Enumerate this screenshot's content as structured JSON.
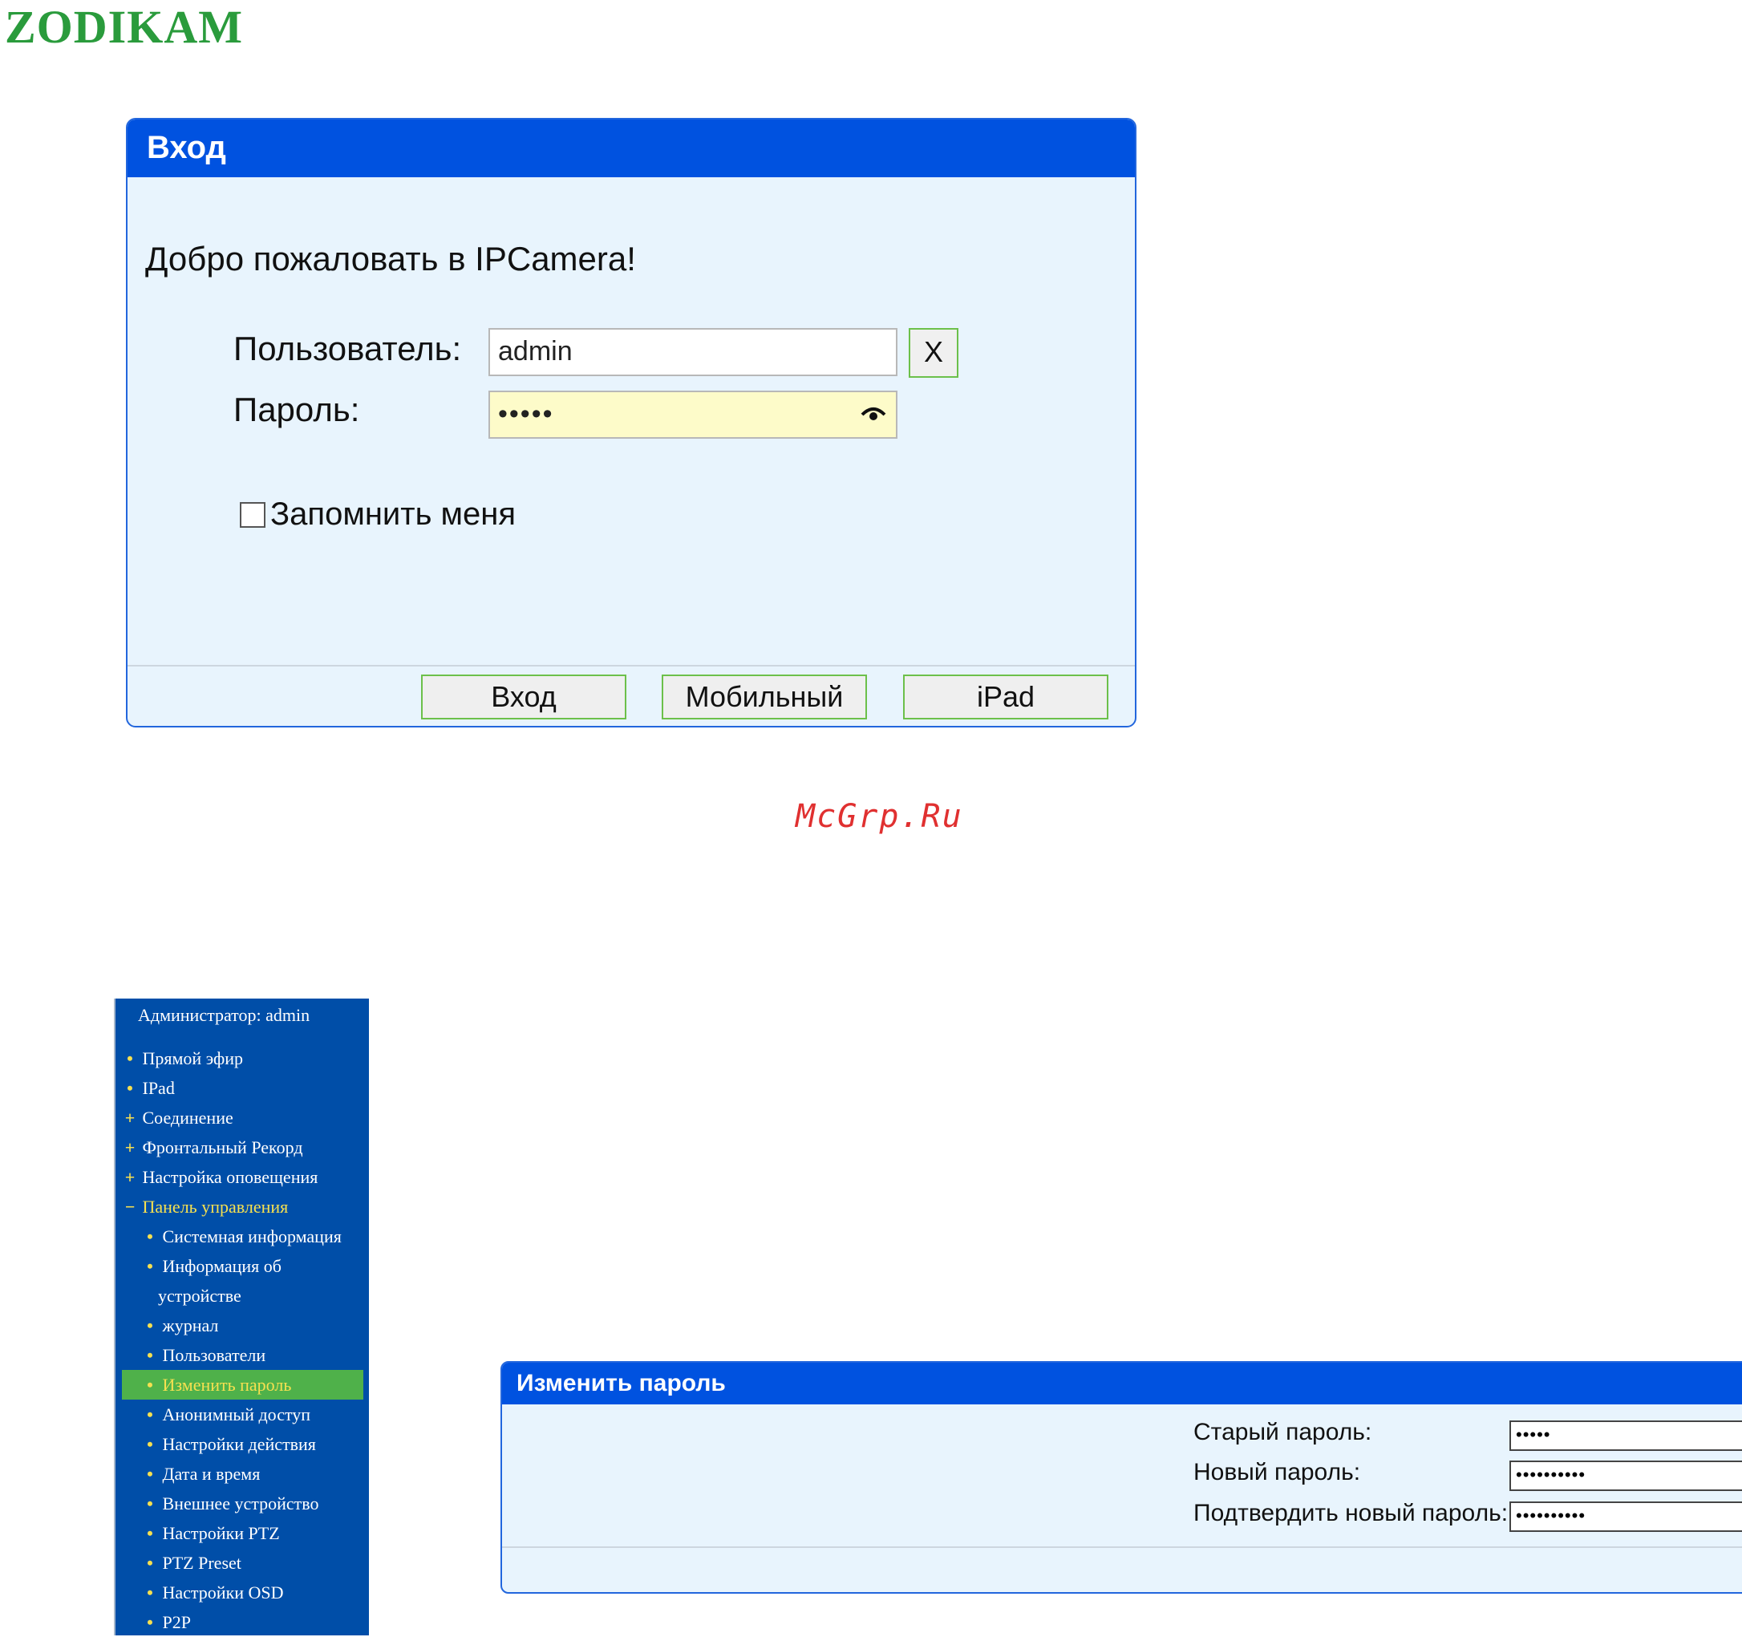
{
  "logo": {
    "text": "ZODIKAM"
  },
  "login": {
    "title": "Вход",
    "welcome": "Добро пожаловать в IPCamera!",
    "user_label": "Пользователь:",
    "user_value": "admin",
    "clear_label": "X",
    "pass_label": "Пароль:",
    "pass_value": "•••••",
    "remember_label": "Запомнить меня",
    "buttons": {
      "login": "Вход",
      "mobile": "Мобильный",
      "ipad": "iPad"
    }
  },
  "watermark": "McGrp.Ru",
  "sidebar": {
    "admin": "Администратор:  admin",
    "items": [
      {
        "marker": "•",
        "label": "Прямой эфир"
      },
      {
        "marker": "•",
        "label": "IPad"
      },
      {
        "marker": "+",
        "label": "Соединение"
      },
      {
        "marker": "+",
        "label": "Фронтальный Рекорд"
      },
      {
        "marker": "+",
        "label": "Настройка оповещения"
      },
      {
        "marker": "−",
        "label": "Панель управления"
      },
      {
        "marker": "•",
        "label": "Системная информация"
      },
      {
        "marker": "•",
        "label": "Информация об"
      },
      {
        "marker": "",
        "label": "устройстве"
      },
      {
        "marker": "•",
        "label": "журнал"
      },
      {
        "marker": "•",
        "label": "Пользователи"
      },
      {
        "marker": "•",
        "label": "Изменить пароль"
      },
      {
        "marker": "•",
        "label": "Анонимный доступ"
      },
      {
        "marker": "•",
        "label": "Настройки действия"
      },
      {
        "marker": "•",
        "label": "Дата и время"
      },
      {
        "marker": "•",
        "label": "Внешнее устройство"
      },
      {
        "marker": "•",
        "label": "Настройки PTZ"
      },
      {
        "marker": "•",
        "label": "PTZ Preset"
      },
      {
        "marker": "•",
        "label": "Настройки OSD"
      },
      {
        "marker": "•",
        "label": "P2P"
      }
    ]
  },
  "change_password": {
    "title": "Изменить пароль",
    "old_label": "Старый пароль:",
    "old_value": "•••••",
    "new_label": "Новый пароль:",
    "new_value": "••••••••••",
    "confirm_label": "Подтвердить новый пароль:",
    "confirm_value": "••••••••••"
  },
  "colors": {
    "header_blue": "#0052e0",
    "sidebar_blue": "#004ea8",
    "active_green": "#4fb14a",
    "logo_green": "#2a9b3c"
  }
}
